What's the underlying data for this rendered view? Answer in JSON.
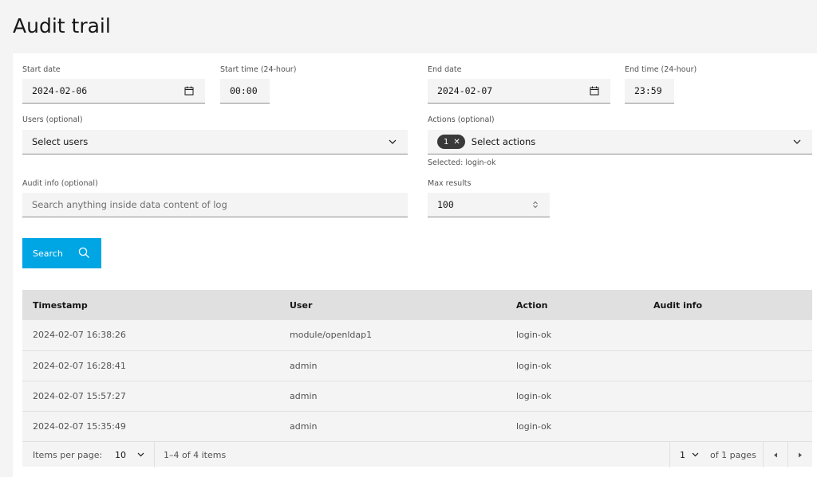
{
  "page_title": "Audit trail",
  "form": {
    "start_date_label": "Start date",
    "start_date_value": "2024-02-06",
    "start_time_label": "Start time (24-hour)",
    "start_time_value": "00:00",
    "end_date_label": "End date",
    "end_date_value": "2024-02-07",
    "end_time_label": "End time (24-hour)",
    "end_time_value": "23:59",
    "users_label": "Users (optional)",
    "users_value": "Select users",
    "actions_label": "Actions (optional)",
    "actions_tag_count": "1",
    "actions_value": "Select actions",
    "actions_helper": "Selected: login-ok",
    "audit_info_label": "Audit info (optional)",
    "audit_info_placeholder": "Search anything inside data content of log",
    "max_results_label": "Max results",
    "max_results_value": "100",
    "search_button": "Search"
  },
  "table": {
    "headers": [
      "Timestamp",
      "User",
      "Action",
      "Audit info"
    ],
    "rows": [
      [
        "2024-02-07 16:38:26",
        "module/openldap1",
        "login-ok",
        ""
      ],
      [
        "2024-02-07 16:28:41",
        "admin",
        "login-ok",
        ""
      ],
      [
        "2024-02-07 15:57:27",
        "admin",
        "login-ok",
        ""
      ],
      [
        "2024-02-07 15:35:49",
        "admin",
        "login-ok",
        ""
      ]
    ]
  },
  "pagination": {
    "items_per_page_label": "Items per page:",
    "items_per_page_value": "10",
    "range_text": "1–4 of 4 items",
    "page_value": "1",
    "of_pages_text": "of 1 pages"
  },
  "colors": {
    "primary_button": "#00a6e4",
    "tag_bg": "#393939",
    "header_bg": "#e0e0e0"
  },
  "icons": {
    "date_picker": "calendar-icon",
    "dropdown": "chevron-down-icon",
    "search": "search-icon",
    "tag_remove": "close-icon",
    "number_stepper": "stepper-icon",
    "prev_page": "caret-left-icon",
    "next_page": "caret-right-icon"
  }
}
